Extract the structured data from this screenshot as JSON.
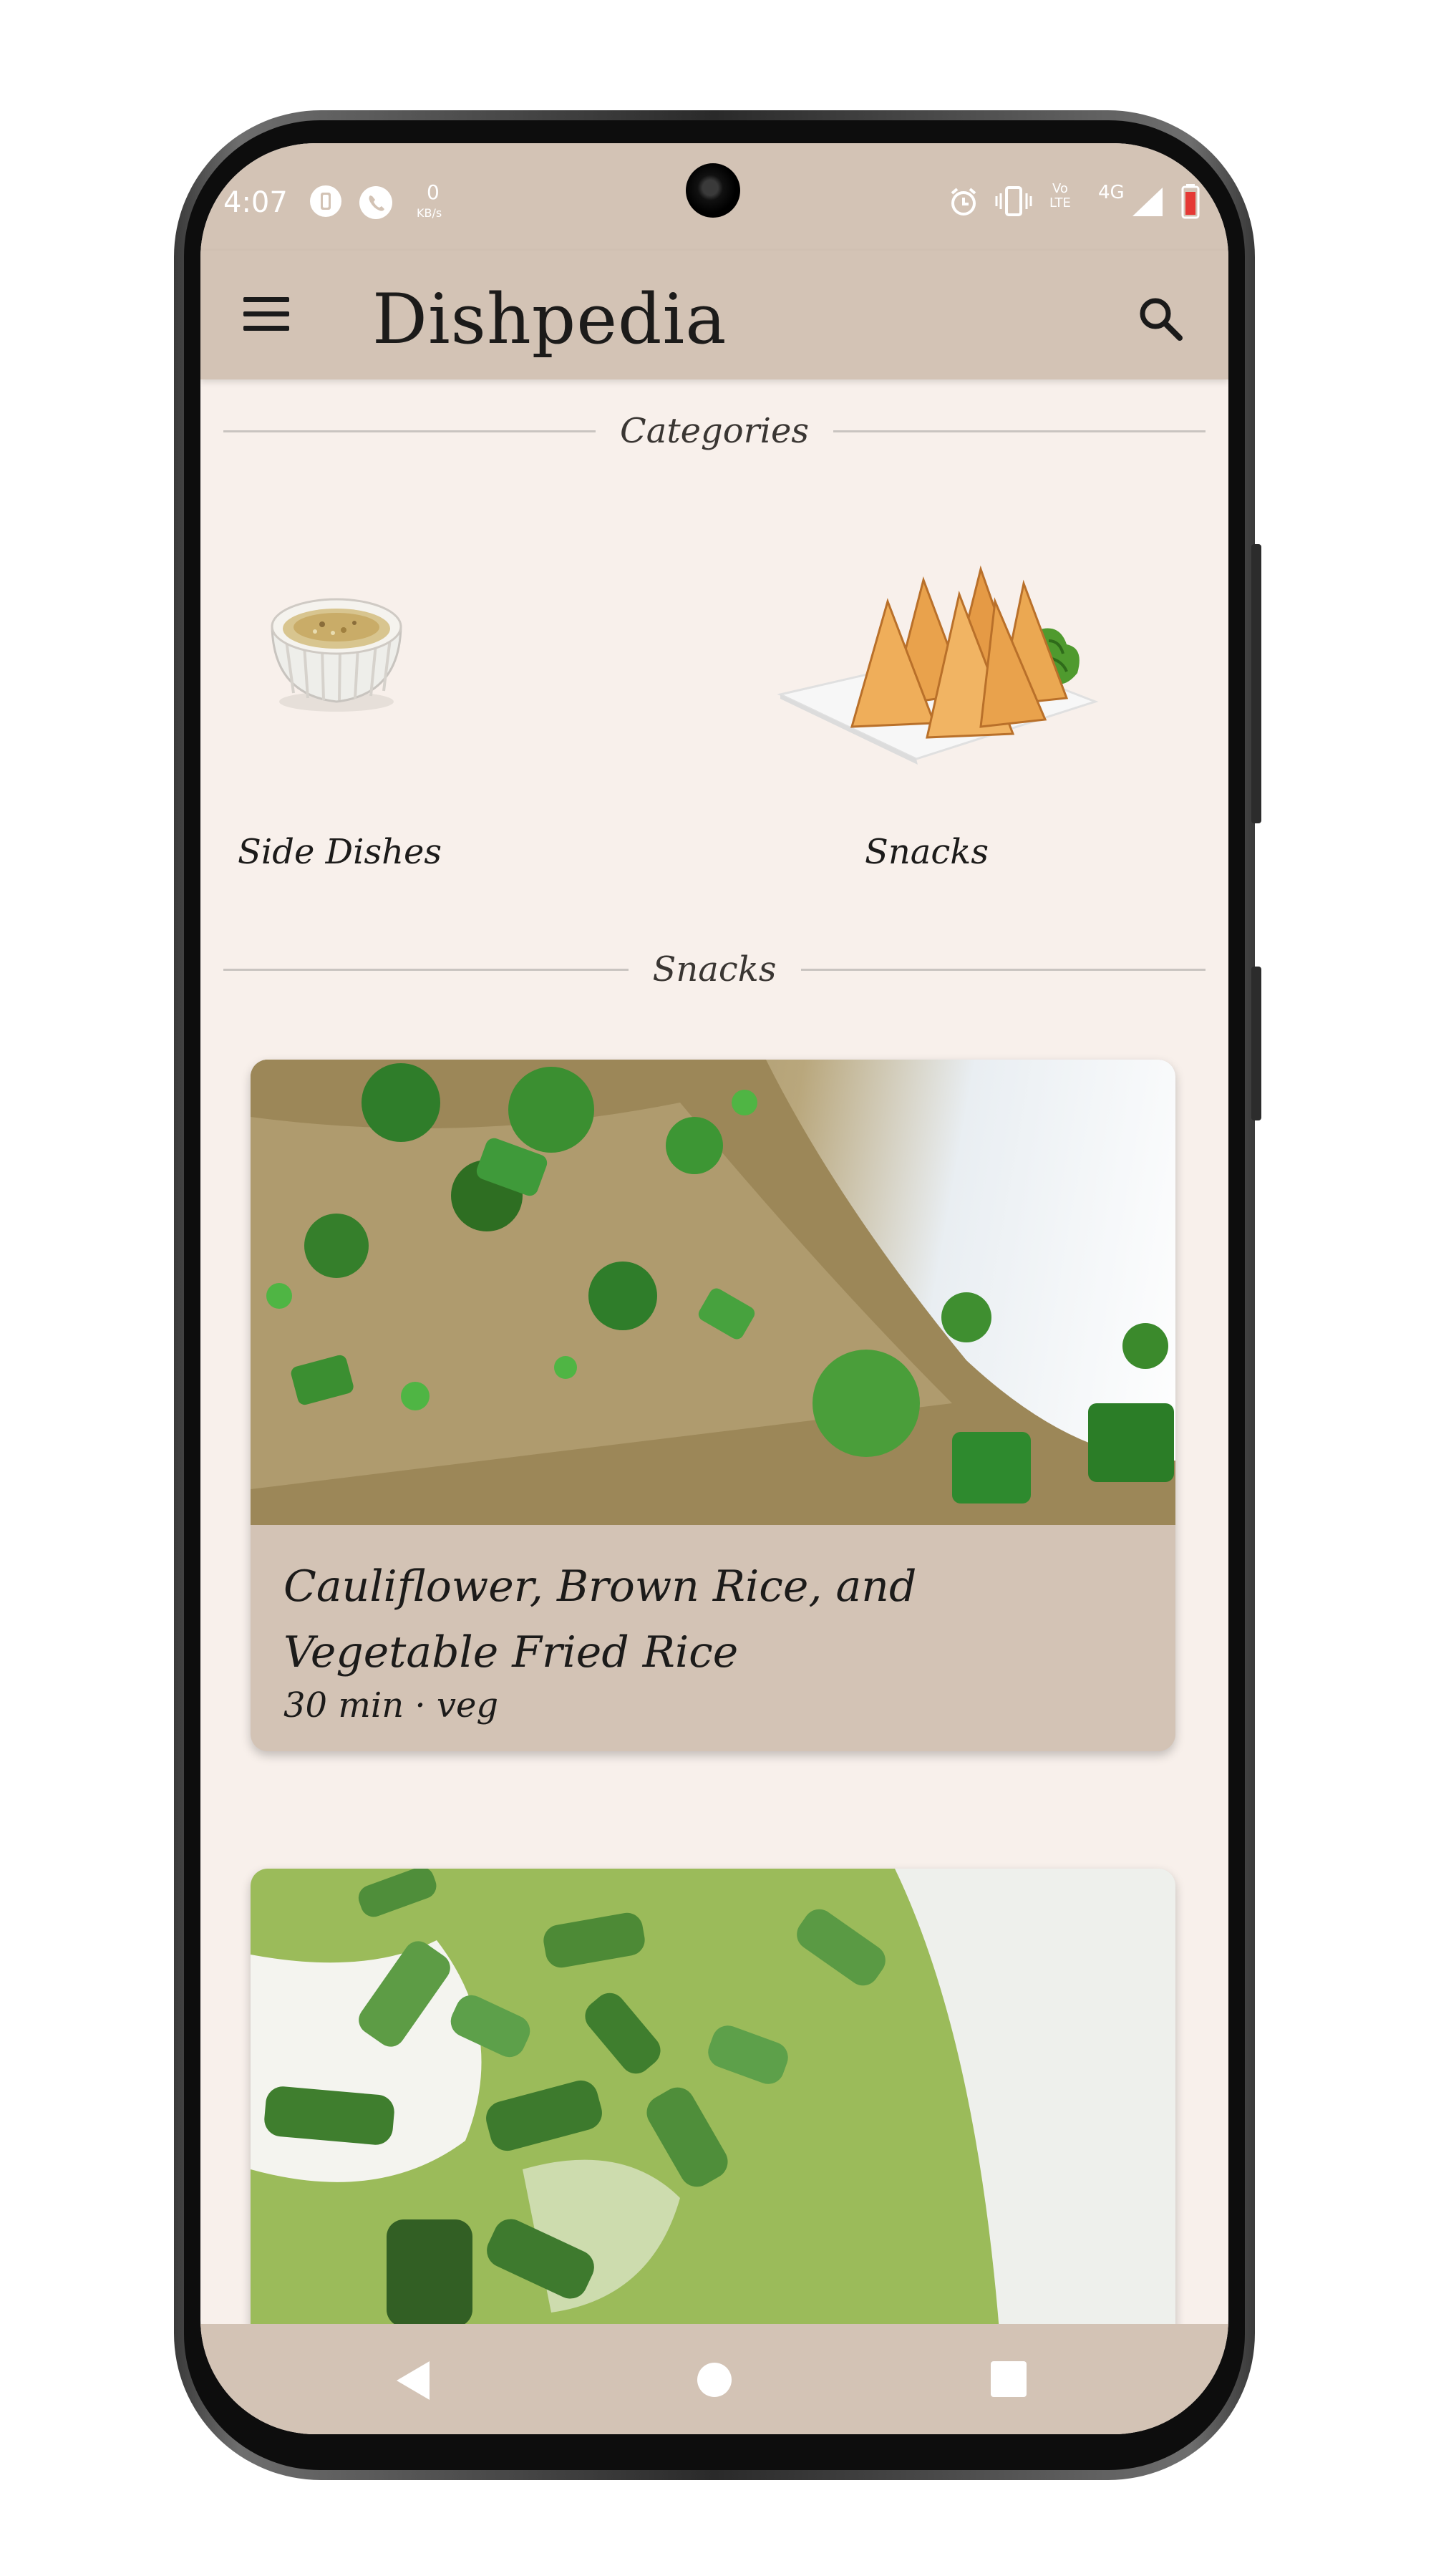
{
  "status_bar": {
    "time": "4:07",
    "data_rate_value": "0",
    "data_rate_unit": "KB/s",
    "volte_top": "Vo",
    "volte_bottom": "LTE",
    "network": "4G",
    "icons": [
      "notification-icon",
      "whatsapp-icon",
      "alarm-icon",
      "vibrate-icon",
      "signal-icon",
      "battery-low-icon"
    ]
  },
  "app_bar": {
    "title": "Dishpedia",
    "menu_icon": "hamburger-menu-icon",
    "search_icon": "search-icon"
  },
  "categories_section": {
    "heading": "Categories",
    "items": [
      {
        "label": "Side Dishes",
        "image": "bowl-of-side-dish-image"
      },
      {
        "label": "Snacks",
        "image": "samosa-plate-image"
      }
    ]
  },
  "snacks_section": {
    "heading": "Snacks",
    "recipes": [
      {
        "title": "Cauliflower, Brown Rice, and Vegetable Fried Rice",
        "meta": "30 min · veg",
        "image": "fried-rice-photo"
      },
      {
        "title": "",
        "meta": "",
        "image": "green-soup-photo"
      }
    ]
  },
  "nav_bar": {
    "back_icon": "back-triangle-icon",
    "home_icon": "home-circle-icon",
    "recents_icon": "recents-square-icon"
  },
  "colors": {
    "bar_background": "#d3c3b5",
    "screen_background": "#f8f0eb",
    "text_primary": "#1c1b1a"
  }
}
